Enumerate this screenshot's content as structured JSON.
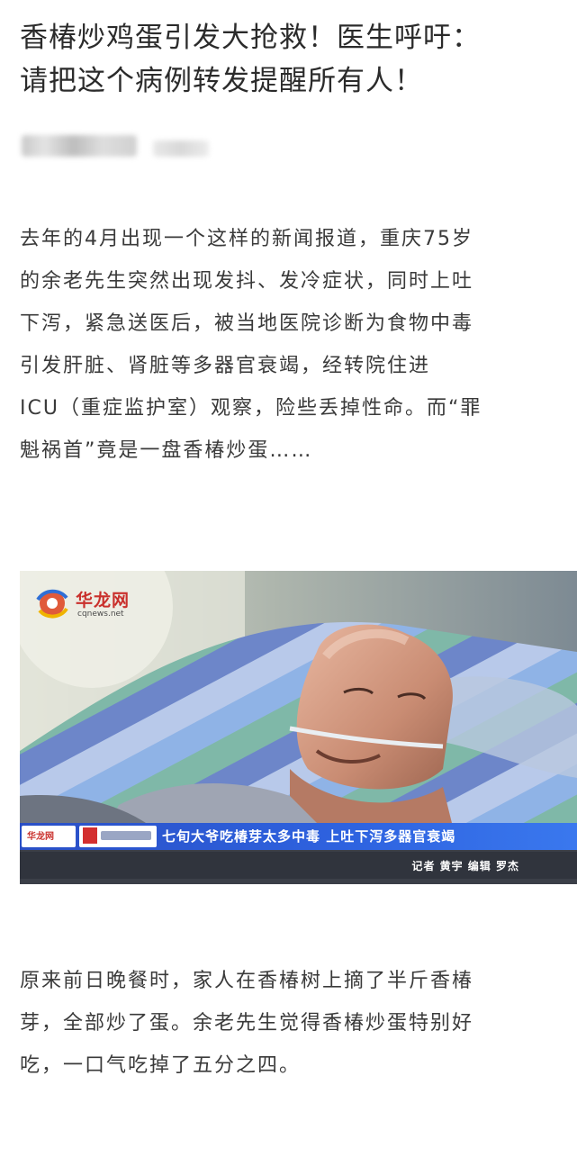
{
  "article": {
    "title_lines": [
      "香椿炒鸡蛋引发大抢救！医生呼吁：",
      "请把这个病例转发提醒所有人！"
    ],
    "paragraph_1_lines": [
      "去年的4月出现一个这样的新闻报道，重庆75岁",
      "的余老先生突然出现发抖、发冷症状，同时上吐",
      "下泻，紧急送医后，被当地医院诊断为食物中毒",
      "引发肝脏、肾脏等多器官衰竭，经转院住进",
      "ICU（重症监护室）观察，险些丢掉性命。而“罪",
      "魁祸首”竟是一盘香椿炒蛋……"
    ],
    "paragraph_2_lines": [
      "原来前日晚餐时，家人在香椿树上摘了半斤香椿",
      "芽，全部炒了蛋。余老先生觉得香椿炒蛋特别好",
      "吃，一口气吃掉了五分之四。"
    ]
  },
  "news_image": {
    "watermark_brand": "华龙网",
    "watermark_domain": "cqnews.net",
    "lower_third_logo": "华龙网",
    "lower_third_headline": "七旬大爷吃椿芽太多中毒 上吐下泻多器官衰竭",
    "credit": "记者 黄宇 编辑 罗杰"
  },
  "colors": {
    "title_text": "#2b2b2b",
    "body_text": "#3a3a3a",
    "brand_red": "#c9302c",
    "lower_third_blue": "#2e63e0"
  }
}
